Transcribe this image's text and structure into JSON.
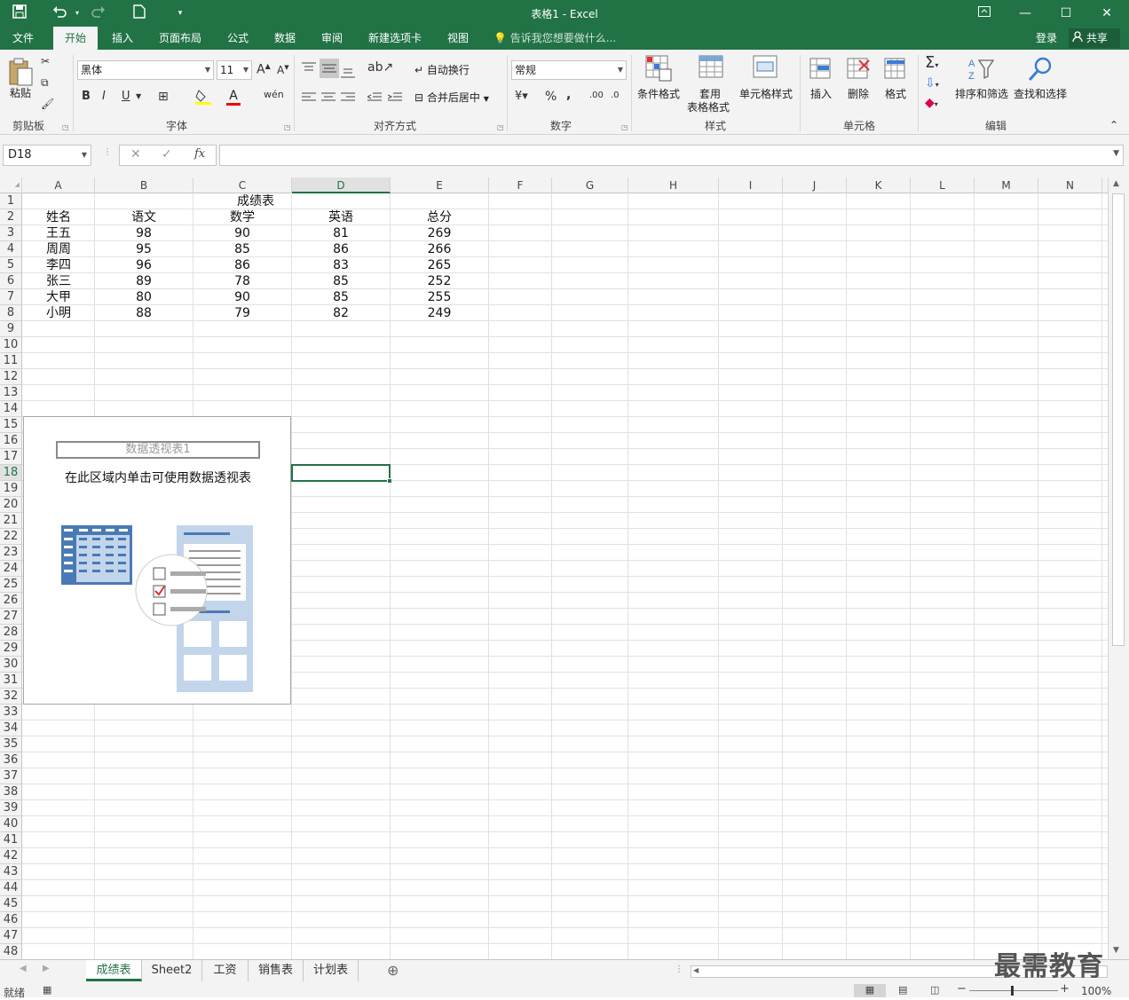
{
  "window": {
    "title": "表格1 - Excel",
    "min_icon": "minimize-icon",
    "max_icon": "maximize-icon",
    "close_icon": "close-icon",
    "ribbon_display_icon": "ribbon-display-icon"
  },
  "menu": {
    "tabs": [
      "文件",
      "开始",
      "插入",
      "页面布局",
      "公式",
      "数据",
      "审阅",
      "新建选项卡",
      "视图"
    ],
    "active": "开始",
    "tell_me": "告诉我您想要做什么...",
    "login": "登录",
    "share": "共享"
  },
  "ribbon": {
    "clipboard": {
      "paste": "粘贴",
      "label": "剪贴板"
    },
    "font": {
      "name": "黑体",
      "size": "11",
      "label": "字体",
      "bold": "B",
      "italic": "I",
      "underline": "U"
    },
    "alignment": {
      "wrap": "自动换行",
      "merge": "合并后居中",
      "label": "对齐方式"
    },
    "number": {
      "format": "常规",
      "label": "数字",
      "percent": "%",
      "comma": ","
    },
    "styles": {
      "conditional": "条件格式",
      "table_line1": "套用",
      "table_line2": "表格格式",
      "cell_styles": "单元格样式",
      "label": "样式"
    },
    "cells": {
      "insert": "插入",
      "delete": "删除",
      "format": "格式",
      "label": "单元格"
    },
    "editing": {
      "sort": "排序和筛选",
      "find": "查找和选择",
      "label": "编辑"
    }
  },
  "formula_bar": {
    "name_box": "D18",
    "fx": "fx",
    "formula": ""
  },
  "columns": [
    "A",
    "B",
    "C",
    "D",
    "E",
    "F",
    "G",
    "H",
    "I",
    "J",
    "K",
    "L",
    "M",
    "N"
  ],
  "selected_column": "D",
  "selected_row": 18,
  "sheet": {
    "title": "成绩表",
    "headers": [
      "姓名",
      "语文",
      "数学",
      "英语",
      "总分"
    ],
    "rows": [
      [
        "王五",
        "98",
        "90",
        "81",
        "269"
      ],
      [
        "周周",
        "95",
        "85",
        "86",
        "266"
      ],
      [
        "李四",
        "96",
        "86",
        "83",
        "265"
      ],
      [
        "张三",
        "89",
        "78",
        "85",
        "252"
      ],
      [
        "大甲",
        "80",
        "90",
        "85",
        "255"
      ],
      [
        "小明",
        "88",
        "79",
        "82",
        "249"
      ]
    ]
  },
  "pivot": {
    "name": "数据透视表1",
    "hint": "在此区域内单击可使用数据透视表"
  },
  "sheet_tabs": [
    "成绩表",
    "Sheet2",
    "工资",
    "销售表",
    "计划表"
  ],
  "active_sheet": "成绩表",
  "status": {
    "ready": "就绪",
    "zoom": "100%"
  },
  "watermark": "最需教育",
  "colors": {
    "accent": "#217346",
    "pivot_blue": "#4a7ab5",
    "pivot_light": "#c3d5ea"
  }
}
